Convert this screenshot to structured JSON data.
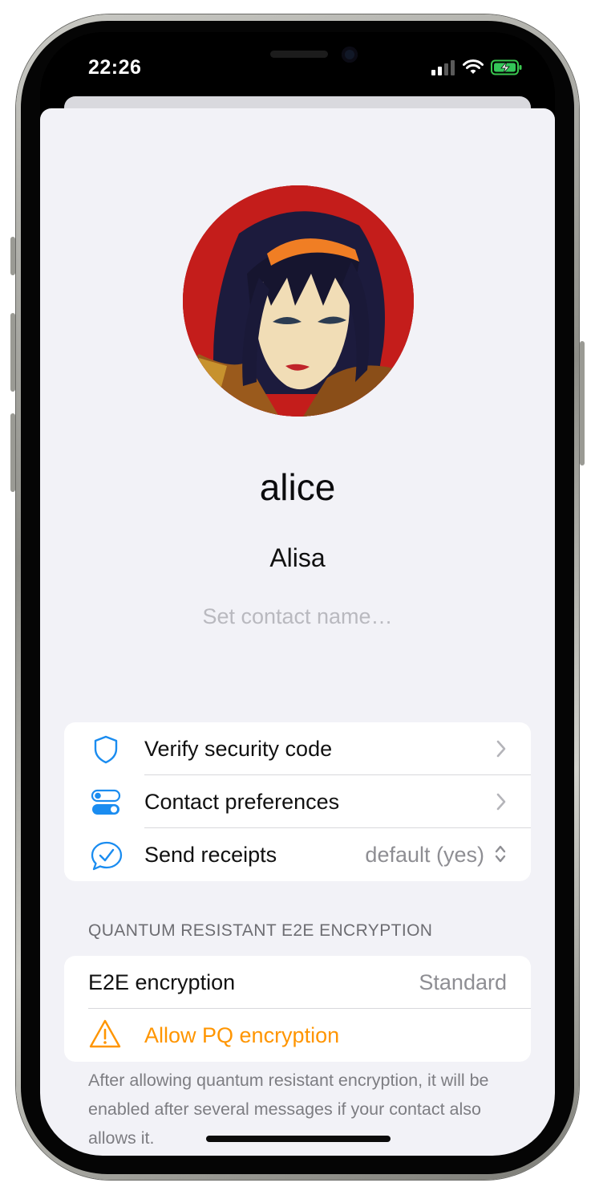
{
  "status_bar": {
    "time": "22:26"
  },
  "profile": {
    "display_name": "alice",
    "full_name": "Alisa",
    "contact_name_placeholder": "Set contact name…"
  },
  "actions": [
    {
      "label": "Verify security code",
      "icon": "shield-icon"
    },
    {
      "label": "Contact preferences",
      "icon": "toggles-icon"
    },
    {
      "label": "Send receipts",
      "icon": "chat-check-icon",
      "value": "default (yes)"
    }
  ],
  "encryption": {
    "section_header": "QUANTUM RESISTANT E2E ENCRYPTION",
    "e2e_label": "E2E encryption",
    "e2e_value": "Standard",
    "allow_pq_label": "Allow PQ encryption",
    "footer_note": "After allowing quantum resistant encryption, it will be enabled after several messages if your contact also allows it."
  },
  "colors": {
    "accent_blue": "#1a8cf0",
    "warning_orange": "#ff9500",
    "background": "#f2f2f7"
  }
}
